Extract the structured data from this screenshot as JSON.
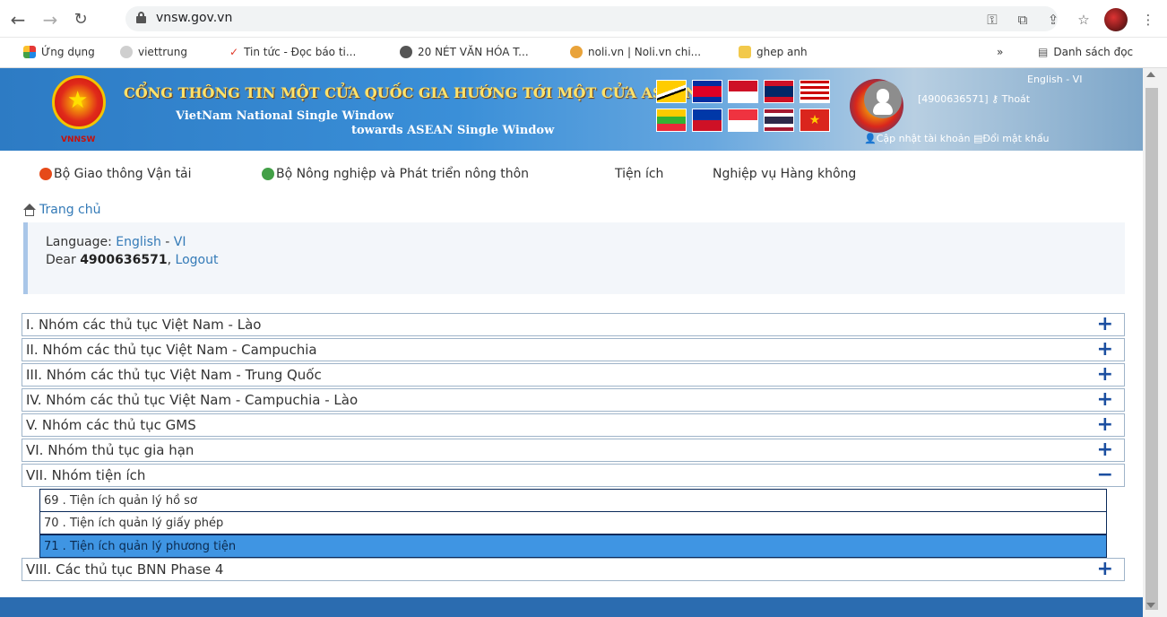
{
  "browser": {
    "url": "vnsw.gov.vn",
    "bookmarks": [
      {
        "label": "Ứng dụng",
        "color": "#e4a700"
      },
      {
        "label": "viettrung",
        "color": "#cfcfcf"
      },
      {
        "label": "Tin tức - Đọc báo ti...",
        "color": "#e03a2a"
      },
      {
        "label": "20 NÉT VĂN HÓA T...",
        "color": "#555555"
      },
      {
        "label": "noli.vn | Noli.vn chi...",
        "color": "#e9a33a"
      },
      {
        "label": "ghep anh",
        "color": "#f2c94c"
      }
    ],
    "reading_list": "Danh sách đọc",
    "more": "»"
  },
  "banner": {
    "title": "CỔNG THÔNG TIN MỘT CỬA QUỐC GIA HƯỚNG TỚI MỘT CỬA ASEAN",
    "subtitle1": "VietNam National Single Window",
    "subtitle2": "towards ASEAN Single Window",
    "logo_text": "VNNSW",
    "lang": "English - VI",
    "account": "[4900636571]",
    "logout": "Thoát",
    "update_account": "Cập nhật tài khoản",
    "change_password": "Đổi mật khẩu"
  },
  "menu": [
    {
      "label": "Bộ Giao thông Vận tải",
      "icon_color": "#e64a19"
    },
    {
      "label": "Bộ Nông nghiệp và Phát triển nông thôn",
      "icon_color": "#43a047"
    },
    {
      "label": "Tiện ích",
      "icon_color": ""
    },
    {
      "label": "Nghiệp vụ Hàng không",
      "icon_color": ""
    }
  ],
  "breadcrumb": "Trang chủ",
  "info": {
    "language_label": "Language:",
    "lang_en": "English",
    "sep": "-",
    "lang_vi": "VI",
    "dear": "Dear",
    "user": "4900636571",
    "logout": "Logout"
  },
  "groups": [
    {
      "title": "I. Nhóm các thủ tục Việt Nam - Lào",
      "sign": "+"
    },
    {
      "title": "II. Nhóm các thủ tục Việt Nam - Campuchia",
      "sign": "+"
    },
    {
      "title": "III. Nhóm các thủ tục Việt Nam - Trung Quốc",
      "sign": "+"
    },
    {
      "title": "IV. Nhóm các thủ tục Việt Nam - Campuchia - Lào",
      "sign": "+"
    },
    {
      "title": "V. Nhóm các thủ tục GMS",
      "sign": "+"
    },
    {
      "title": "VI. Nhóm thủ tục gia hạn",
      "sign": "+"
    },
    {
      "title": "VII. Nhóm tiện ích",
      "sign": "−"
    }
  ],
  "subitems": [
    {
      "title": "69 . Tiện ích quản lý hồ sơ"
    },
    {
      "title": "70 . Tiện ích quản lý giấy phép"
    },
    {
      "title": "71 . Tiện ích quản lý phương tiện"
    }
  ],
  "last_group": {
    "title": "VIII. Các thủ tục BNN Phase 4",
    "sign": "+"
  }
}
